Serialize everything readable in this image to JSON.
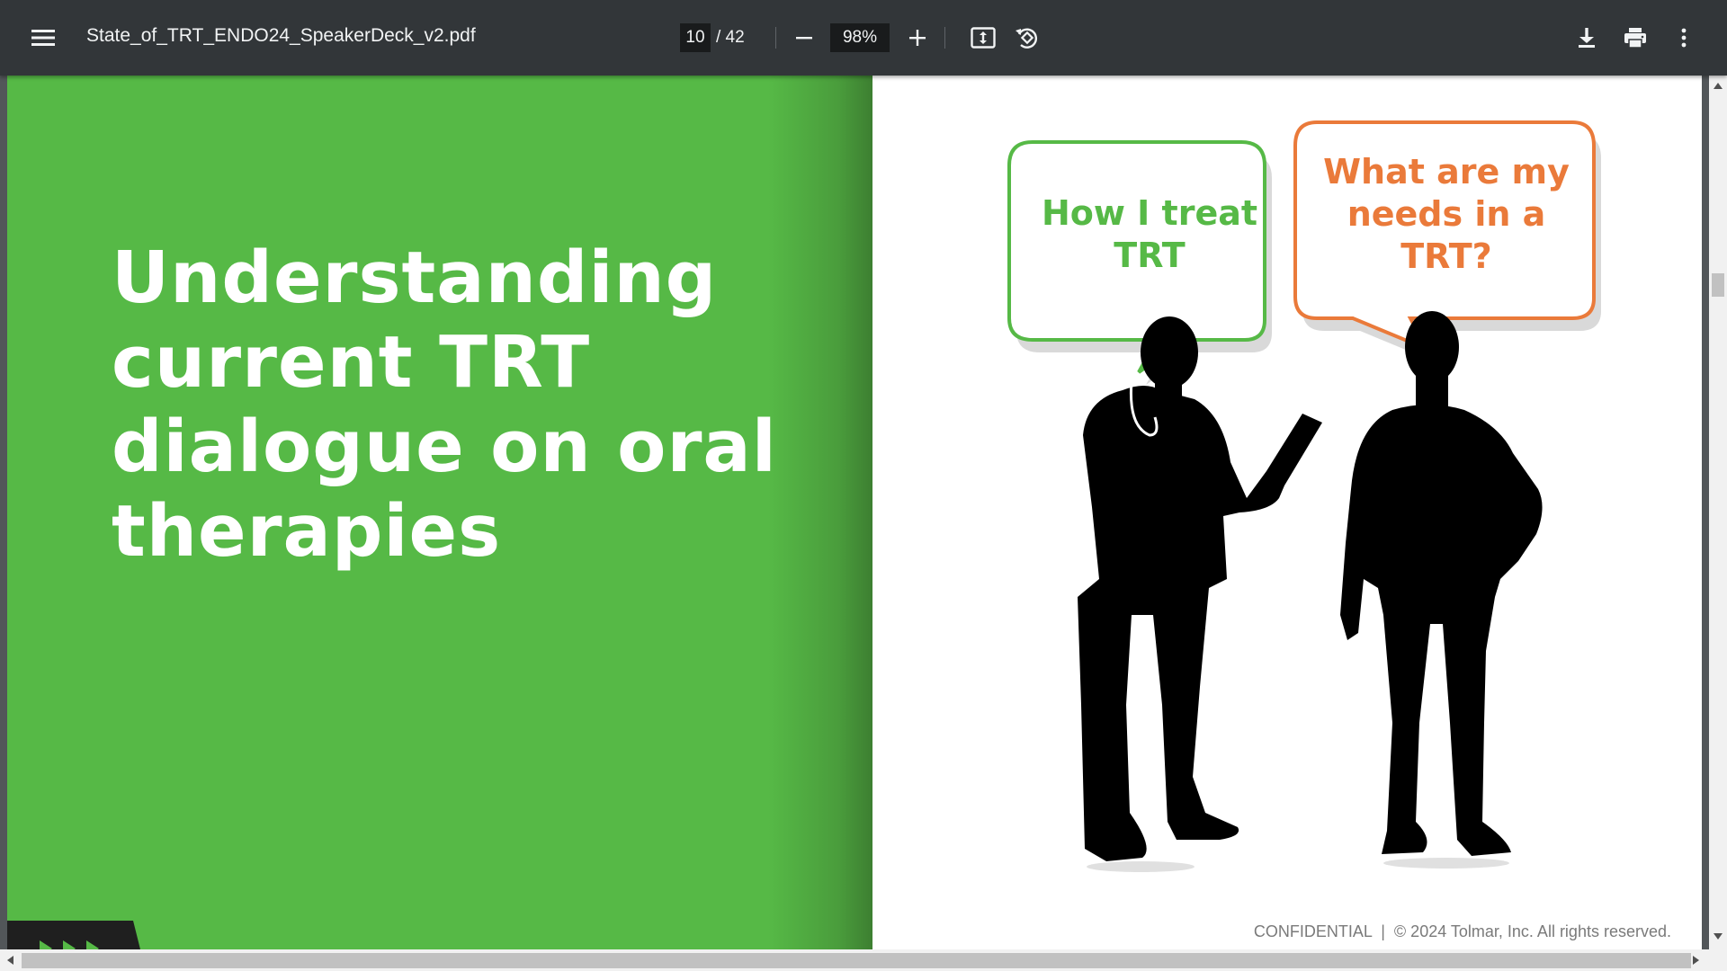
{
  "toolbar": {
    "menu_icon": "menu-icon",
    "file_name": "State_of_TRT_ENDO24_SpeakerDeck_v2.pdf",
    "current_page": "10",
    "page_total": "/ 42",
    "zoom_out_icon": "minus-icon",
    "zoom_value": "98%",
    "zoom_in_icon": "plus-icon",
    "fit_icon": "fit-to-page-icon",
    "rotate_icon": "rotate-counterclockwise-icon",
    "download_icon": "download-icon",
    "print_icon": "print-icon",
    "more_icon": "more-vertical-icon"
  },
  "slide": {
    "title_lines": [
      "Understanding",
      "current TRT",
      "dialogue on oral",
      "therapies"
    ],
    "bubble_left": [
      "How I treat",
      "TRT"
    ],
    "bubble_right": [
      "What are my",
      "needs in a",
      "TRT?"
    ],
    "footer": "CONFIDENTIAL  |  © 2024 Tolmar, Inc. All rights reserved.",
    "colors": {
      "green": "#56b946",
      "orange": "#ea7a3a",
      "toolbar": "#323639",
      "viewer_bg": "#525659"
    }
  }
}
